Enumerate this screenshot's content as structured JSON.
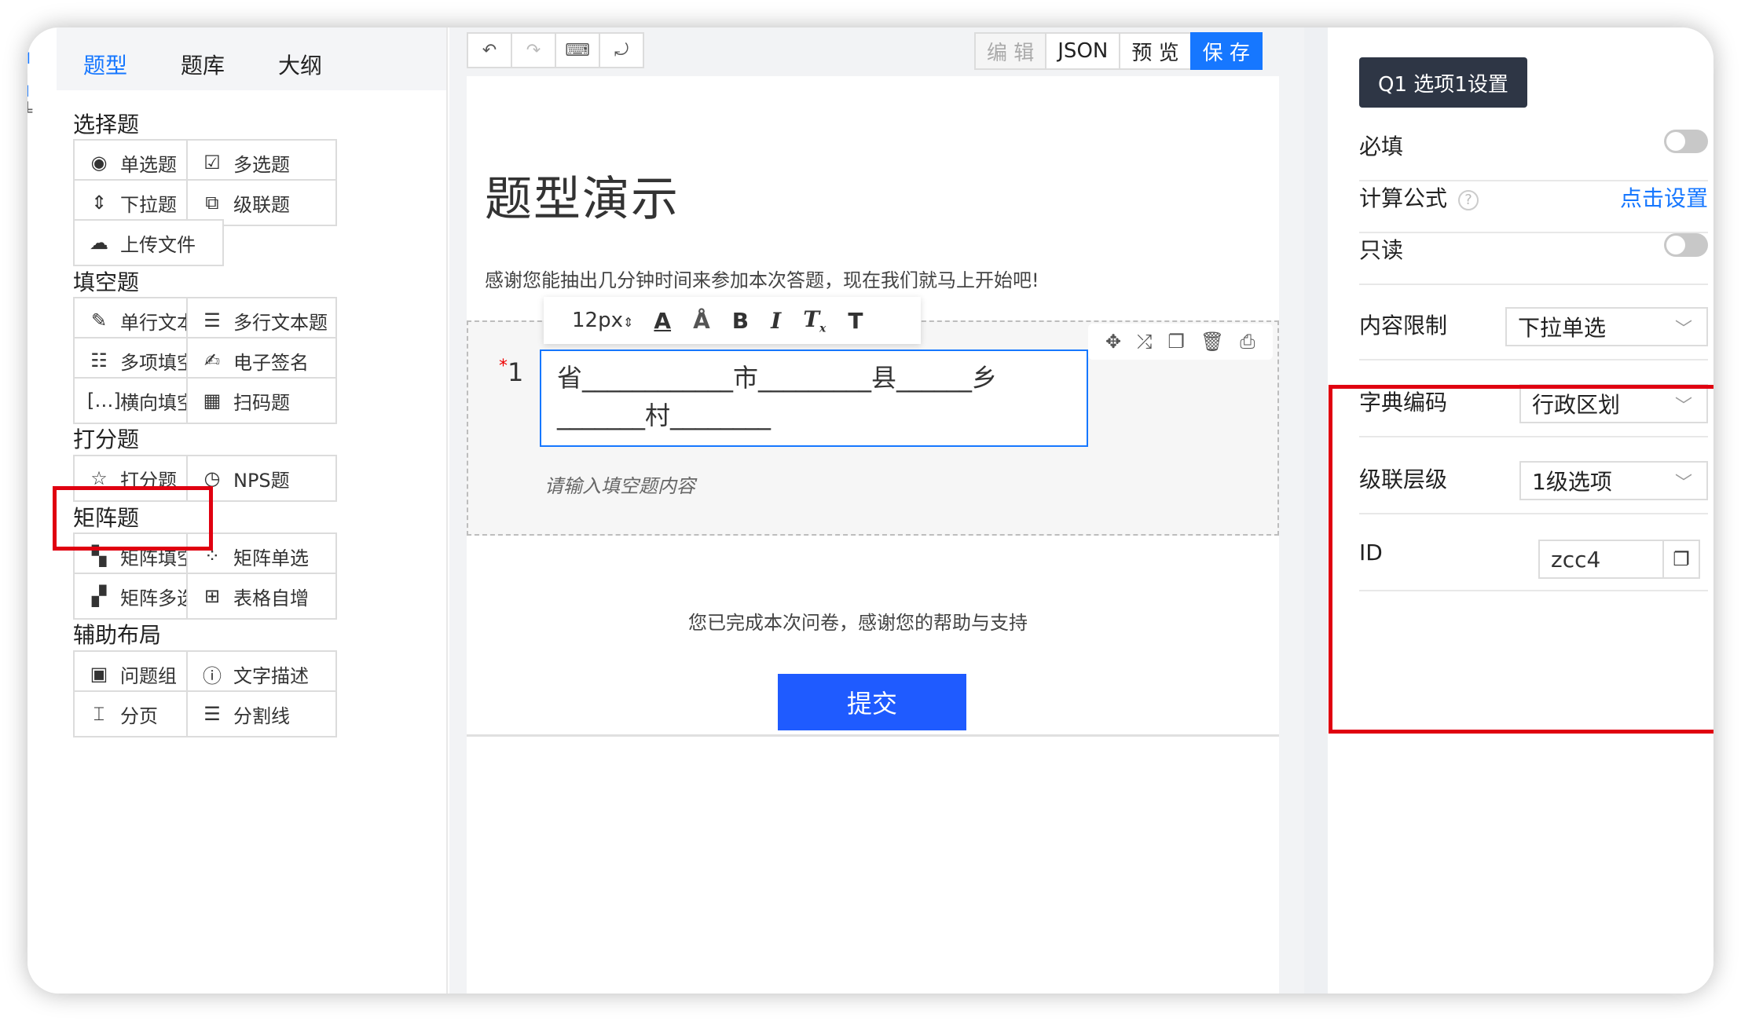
{
  "left_tabs": [
    {
      "label": "题型",
      "active": true
    },
    {
      "label": "题库",
      "active": false
    },
    {
      "label": "大纲",
      "active": false
    }
  ],
  "sections": {
    "choice": {
      "title": "选择题",
      "items": [
        {
          "label": "单选题",
          "icon": "radio-icon"
        },
        {
          "label": "多选题",
          "icon": "checkbox-icon"
        },
        {
          "label": "下拉题",
          "icon": "sort-arrows-icon"
        },
        {
          "label": "级联题",
          "icon": "cascade-icon"
        },
        {
          "label": "上传文件",
          "icon": "cloud-upload-icon"
        }
      ]
    },
    "fill": {
      "title": "填空题",
      "items": [
        {
          "label": "单行文本题",
          "icon": "edit-icon"
        },
        {
          "label": "多行文本题",
          "icon": "multiline-icon"
        },
        {
          "label": "多项填空",
          "icon": "list-box-icon"
        },
        {
          "label": "电子签名",
          "icon": "signature-icon"
        },
        {
          "label": "横向填空",
          "icon": "bracket-ellipsis-icon"
        },
        {
          "label": "扫码题",
          "icon": "qrcode-icon"
        }
      ]
    },
    "score": {
      "title": "打分题",
      "items": [
        {
          "label": "打分题",
          "icon": "star-icon"
        },
        {
          "label": "NPS题",
          "icon": "gauge-icon"
        }
      ]
    },
    "matrix": {
      "title": "矩阵题",
      "items": [
        {
          "label": "矩阵填空",
          "icon": "matrix-fill-icon"
        },
        {
          "label": "矩阵单选",
          "icon": "matrix-radio-icon"
        },
        {
          "label": "矩阵多选",
          "icon": "matrix-check-icon"
        },
        {
          "label": "表格自增",
          "icon": "table-add-icon"
        }
      ]
    },
    "layout": {
      "title": "辅助布局",
      "items": [
        {
          "label": "问题组",
          "icon": "group-icon"
        },
        {
          "label": "文字描述",
          "icon": "exclamation-circle-icon"
        },
        {
          "label": "分页",
          "icon": "page-break-icon"
        },
        {
          "label": "分割线",
          "icon": "divider-lines-icon"
        }
      ]
    }
  },
  "toolbar": {
    "modes": [
      {
        "label": "编 辑",
        "state": "dim"
      },
      {
        "label": "JSON",
        "state": "normal"
      },
      {
        "label": "预 览",
        "state": "normal"
      },
      {
        "label": "保 存",
        "state": "primary"
      }
    ]
  },
  "survey": {
    "title": "题型演示",
    "intro": "感谢您能抽出几分钟时间来参加本次答题，现在我们就马上开始吧!",
    "question_number": "1",
    "required_mark": "*",
    "question_line1": "省____________市_________县______乡",
    "question_line2": "_______村________",
    "hint": "请输入填空题内容",
    "thanks": "您已完成本次问卷，感谢您的帮助与支持",
    "submit": "提交"
  },
  "format_bar": {
    "font_size": "12px"
  },
  "right_panel": {
    "title": "Q1 选项1设置",
    "required_label": "必填",
    "formula_label": "计算公式",
    "formula_link": "点击设置",
    "readonly_label": "只读",
    "content_limit_label": "内容限制",
    "content_limit_value": "下拉单选",
    "dict_label": "字典编码",
    "dict_value": "行政区划",
    "level_label": "级联层级",
    "level_value": "1级选项",
    "id_label": "ID",
    "id_value": "zcc4"
  },
  "colors": {
    "accent": "#1677ff",
    "submit": "#1f5bff",
    "highlight": "#e00010",
    "title_badge": "#2e3645"
  }
}
